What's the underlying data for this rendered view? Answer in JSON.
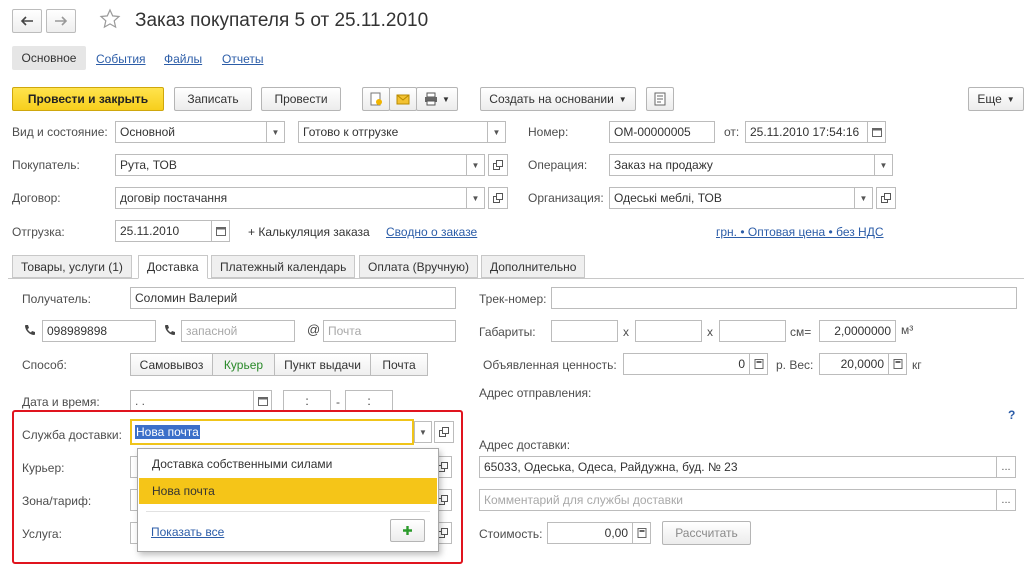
{
  "window": {
    "title": "Заказ покупателя 5 от 25.11.2010"
  },
  "nav_tabs": [
    {
      "label": "Основное"
    },
    {
      "label": "События"
    },
    {
      "label": "Файлы"
    },
    {
      "label": "Отчеты"
    }
  ],
  "toolbar": {
    "post_close": "Провести и закрыть",
    "save": "Записать",
    "post": "Провести",
    "create_based": "Создать на основании",
    "more": "Еще"
  },
  "header": {
    "kind_label": "Вид и состояние:",
    "kind_value": "Основной",
    "state_value": "Готово к отгрузке",
    "number_label": "Номер:",
    "number_value": "ОМ-00000005",
    "date_label": "от:",
    "date_value": "25.11.2010 17:54:16",
    "customer_label": "Покупатель:",
    "customer_value": "Рута, ТОВ",
    "operation_label": "Операция:",
    "operation_value": "Заказ на продажу",
    "contract_label": "Договор:",
    "contract_value": "договір постачання",
    "org_label": "Организация:",
    "org_value": "Одеські меблі, ТОВ",
    "shipment_label": "Отгрузка:",
    "shipment_value": "25.11.2010",
    "calc_label": "+ Калькуляция заказа",
    "summary_link": "Сводно о заказе",
    "price_link": "грн. • Оптовая цена • без НДС"
  },
  "doc_tabs": [
    {
      "label": "Товары, услуги (1)"
    },
    {
      "label": "Доставка"
    },
    {
      "label": "Платежный календарь"
    },
    {
      "label": "Оплата (Вручную)"
    },
    {
      "label": "Дополнительно"
    }
  ],
  "delivery": {
    "recipient_label": "Получатель:",
    "recipient_value": "Соломин Валерий",
    "phone_value": "098989898",
    "phone2_placeholder": "запасной",
    "email_placeholder": "Почта",
    "method_label": "Способ:",
    "methods": [
      "Самовывоз",
      "Курьер",
      "Пункт выдачи",
      "Почта"
    ],
    "datetime_label": "Дата и время:",
    "date_placeholder": " .  .",
    "time_from_placeholder": ":",
    "time_dash": "-",
    "time_to_placeholder": ":",
    "service_label": "Служба доставки:",
    "service_value": "Нова почта",
    "courier_label": "Курьер:",
    "zone_label": "Зона/тариф:",
    "service2_label": "Услуга:",
    "dropdown": {
      "options": [
        "Доставка собственными силами",
        "Нова почта"
      ],
      "selected_index": 1,
      "show_all": "Показать все"
    },
    "track_label": "Трек-номер:",
    "dims_label": "Габариты:",
    "x1": "x",
    "x2": "x",
    "cm_label": "см=",
    "volume_value": "2,0000000",
    "volume_unit": "м³",
    "declared_label": "Объявленная ценность:",
    "declared_value": "0",
    "currency_weight_label": "р. Вес:",
    "weight_value": "20,0000",
    "weight_unit": "кг",
    "from_address_label": "Адрес отправления:",
    "help_mark": "?",
    "to_address_label": "Адрес доставки:",
    "to_address_value": "65033, Одеська, Одеса, Райдужна, буд. № 23",
    "comment_placeholder": "Комментарий для службы доставки",
    "cost_label": "Стоимость:",
    "cost_value": "0,00",
    "calculate_btn": "Рассчитать"
  },
  "colors": {
    "accent_yellow": "#f7cf1c",
    "highlight_red": "#e0141e",
    "selection_yellow": "#f5c518",
    "link_blue": "#2c5da8"
  }
}
